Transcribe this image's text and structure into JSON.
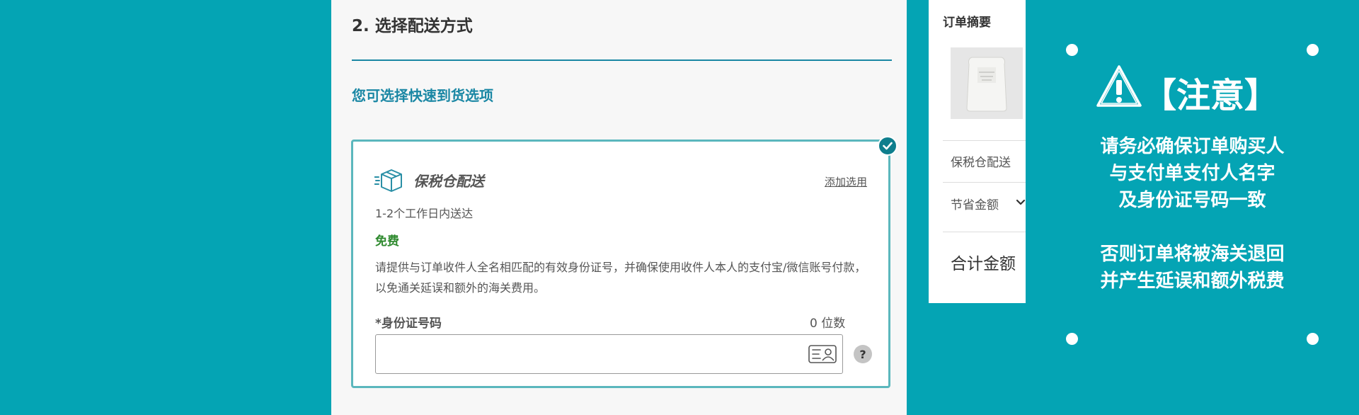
{
  "checkout": {
    "section_title": "2. 选择配送方式",
    "fast_delivery_heading": "您可选择快速到货选项",
    "option": {
      "name": "保税仓配送",
      "add_option_link": "添加选用",
      "eta": "1-2个工作日内送达",
      "price": "免费",
      "id_notice": "请提供与订单收件人全名相匹配的有效身份证号，并确保使用收件人本人的支付宝/微信账号付款，以免通关延误和额外的海关费用。",
      "id_label_required": "*",
      "id_label": "身份证号码",
      "digit_counter": "0 位数",
      "id_value": "",
      "help_label": "?"
    }
  },
  "summary": {
    "title": "订单摘要",
    "shipping_label": "保税仓配送",
    "savings_label": "节省金额",
    "total_label": "合计金额"
  },
  "notice": {
    "heading": "【注意】",
    "line1": "请务必确保订单购买人",
    "line2": "与支付单支付人名字",
    "line3": "及身份证号码一致",
    "line4": "否则订单将被海关退回",
    "line5": "并产生延误和额外税费"
  },
  "colors": {
    "brand_teal": "#04a4b4",
    "heading_blue": "#1a87a4",
    "price_green": "#2f8a2f",
    "card_border": "#5bb7bd"
  }
}
